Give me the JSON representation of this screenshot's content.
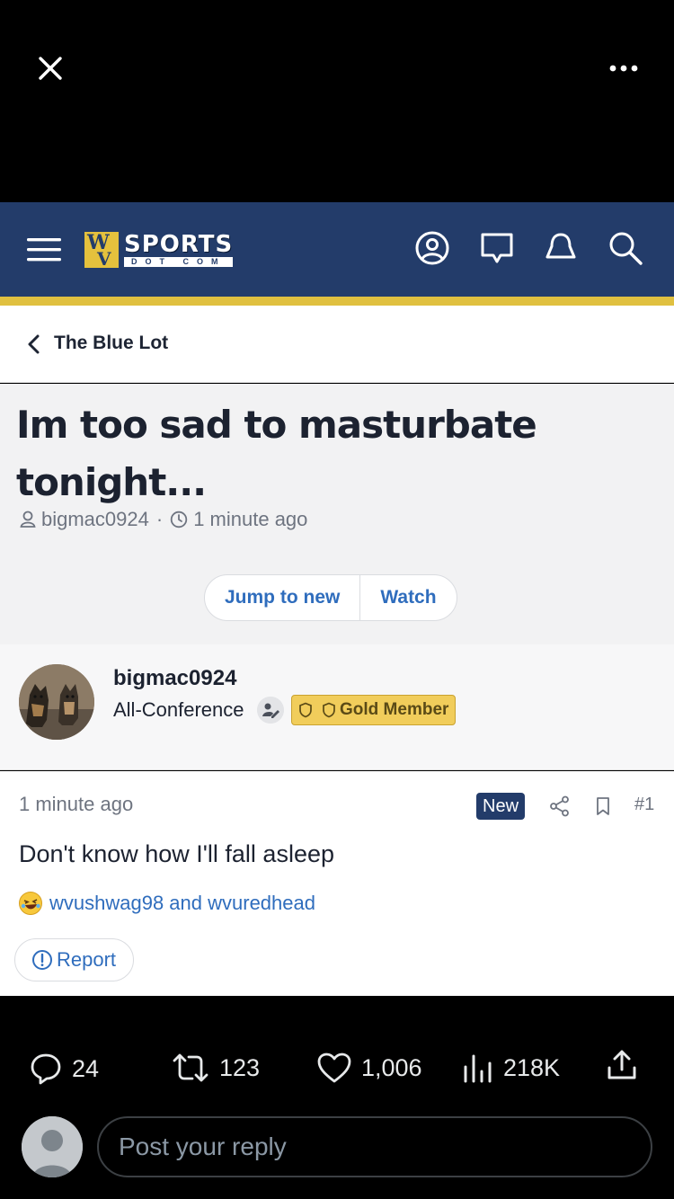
{
  "viewer": {
    "close_icon": "close-icon",
    "more_icon": "more-horizontal-icon"
  },
  "site": {
    "logo_letters": "WV",
    "logo_word": "SPORTS",
    "logo_sub": "DOT COM",
    "header_icons": [
      "account-icon",
      "messages-icon",
      "alerts-icon",
      "search-icon"
    ],
    "brand_color": "#233c6a",
    "accent_color": "#e0c040"
  },
  "breadcrumb": {
    "label": "The Blue Lot"
  },
  "thread": {
    "title": "Im too sad to masturbate tonight...",
    "author": "bigmac0924",
    "time": "1 minute ago",
    "jump_label": "Jump to new",
    "watch_label": "Watch"
  },
  "user": {
    "name": "bigmac0924",
    "title": "All-Conference",
    "badge": "Gold Member"
  },
  "post": {
    "time": "1 minute ago",
    "new_label": "New",
    "number": "#1",
    "body": "Don't know how I'll fall asleep",
    "reactions": "wvushwag98 and wvuredhead",
    "report_label": "Report"
  },
  "actions": {
    "replies": "24",
    "reposts": "123",
    "likes": "1,006",
    "views": "218K"
  },
  "reply": {
    "placeholder": "Post your reply"
  }
}
